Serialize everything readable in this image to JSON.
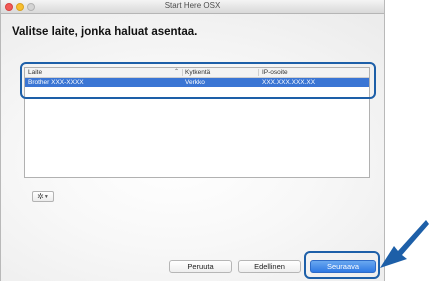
{
  "window": {
    "title": "Start Here OSX"
  },
  "heading": "Valitse laite, jonka haluat asentaa.",
  "table": {
    "columns": [
      "Laite",
      "Kytkentä",
      "IP-osoite"
    ],
    "rows": [
      {
        "device": "Brother XXX-XXXX",
        "connection": "Verkko",
        "ip": "XXX.XXX.XXX.XX"
      }
    ]
  },
  "buttons": {
    "cancel": "Peruuta",
    "previous": "Edellinen",
    "next": "Seuraava"
  },
  "icons": {
    "gear": "gear-icon",
    "chevron": "chevron-down-icon",
    "sort": "sort-icon",
    "arrow": "pointer-arrow-icon"
  },
  "colors": {
    "selection": "#3a75d4",
    "highlight": "#1d5fa8",
    "primary_button": "#2f79e3"
  }
}
